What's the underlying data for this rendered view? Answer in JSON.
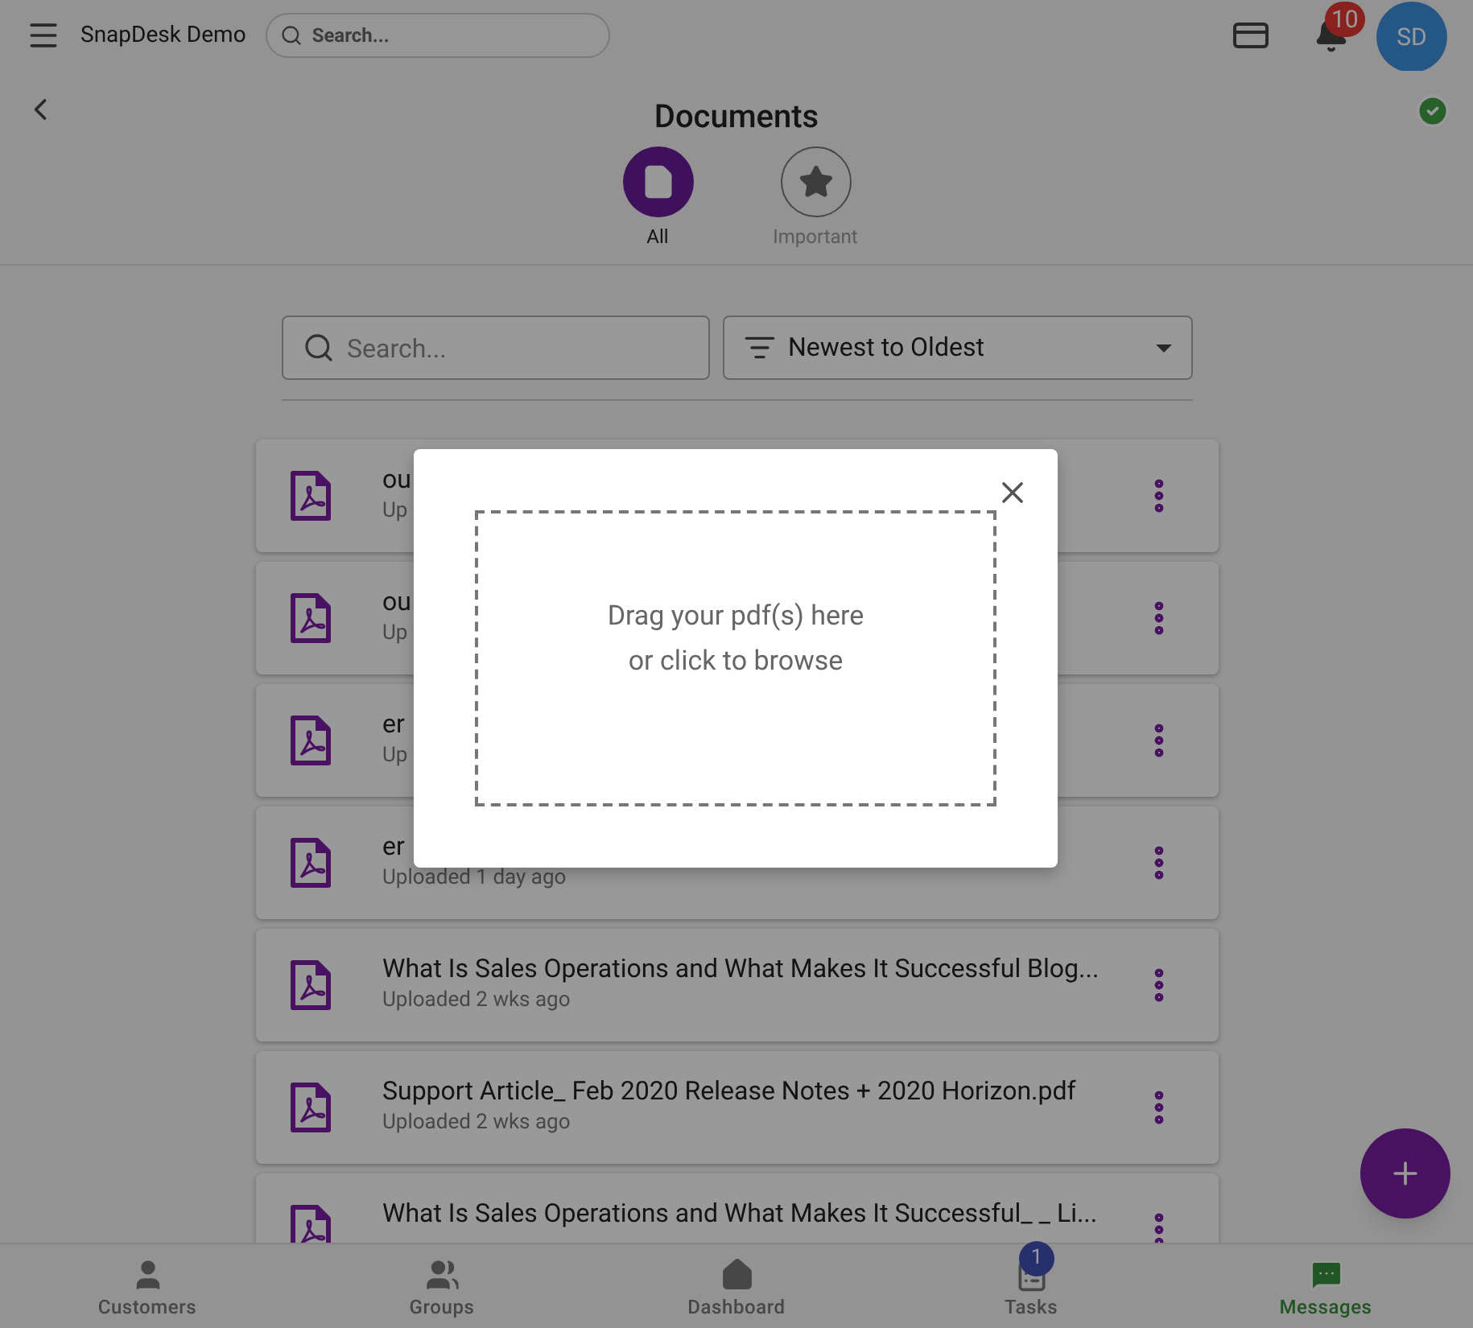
{
  "app_bar": {
    "title": "SnapDesk Demo",
    "search": {
      "placeholder": "Search..."
    },
    "notification_count": "10",
    "avatar": "SD"
  },
  "page": {
    "title": "Documents",
    "verified": true
  },
  "tabs": [
    {
      "label": "All",
      "selected": true,
      "kind": "file"
    },
    {
      "label": "Important",
      "selected": false,
      "kind": "star"
    }
  ],
  "filter": {
    "search": {
      "placeholder": "Search..."
    },
    "sort": "Newest to Oldest"
  },
  "documents": [
    {
      "name": "ou",
      "meta": "Up"
    },
    {
      "name": "ou",
      "meta": "Up"
    },
    {
      "name": "er",
      "meta": "Up"
    },
    {
      "name": "er",
      "meta": "Uploaded 1 day ago"
    },
    {
      "name": "What Is Sales Operations and What Makes It Successful Blog...",
      "meta": "Uploaded 2 wks ago"
    },
    {
      "name": "Support Article_ Feb 2020 Release Notes + 2020 Horizon.pdf",
      "meta": "Uploaded 2 wks ago"
    },
    {
      "name": "What Is Sales Operations and What Makes It Successful_ _ Li..."
    }
  ],
  "modal": {
    "lines": [
      "Drag your pdf(s) here",
      "or click to browse"
    ]
  },
  "bottom_nav": [
    {
      "label": "Customers",
      "selected": false,
      "kind": "person"
    },
    {
      "label": "Groups",
      "selected": false,
      "kind": "group"
    },
    {
      "label": "Dashboard",
      "selected": false,
      "kind": "home"
    },
    {
      "label": "Tasks",
      "selected": false,
      "kind": "tasks",
      "badge": "1"
    },
    {
      "label": "Messages",
      "selected": true,
      "kind": "messages"
    }
  ]
}
